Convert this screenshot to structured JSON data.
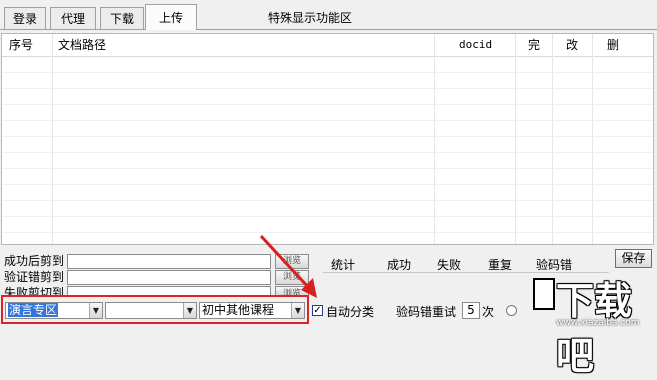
{
  "tabs": [
    {
      "label": "登录",
      "active": false
    },
    {
      "label": "代理",
      "active": false
    },
    {
      "label": "下载",
      "active": false
    },
    {
      "label": "上传",
      "active": true
    }
  ],
  "special_area": "特殊显示功能区",
  "table": {
    "columns": [
      "序号",
      "文档路径",
      "docid",
      "完",
      "改",
      "删"
    ],
    "rows": []
  },
  "paths": [
    {
      "label": "成功后剪到",
      "value": "",
      "browse": "浏览"
    },
    {
      "label": "验证错剪到",
      "value": "",
      "browse": "浏览"
    },
    {
      "label": "失败剪切到",
      "value": "",
      "browse": "浏览"
    }
  ],
  "stats": {
    "headers": [
      "统计",
      "成功",
      "失败",
      "重复",
      "验码错"
    ],
    "save_label": "保存"
  },
  "combos": {
    "first": "演言专区",
    "second": "",
    "third": "初中其他课程"
  },
  "auto_classify": {
    "label": "自动分类",
    "checked": true
  },
  "retry": {
    "label": "验码错重试",
    "value": "5",
    "unit": "次"
  },
  "watermark": {
    "text": "下载吧",
    "url": "www.xiazaiba.com"
  },
  "colors": {
    "highlight_box": "#e12222",
    "arrow": "#d91f1f",
    "selection": "#3375d8"
  }
}
